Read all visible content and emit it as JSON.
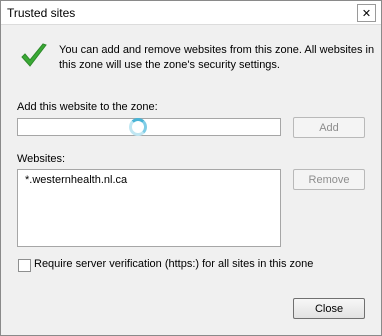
{
  "dialog": {
    "title": "Trusted sites",
    "close_glyph": "✕",
    "info_text": "You can add and remove websites from this zone. All websites in this zone will use the zone's security settings."
  },
  "add_section": {
    "label": "Add this website to the zone:",
    "input_value": "",
    "add_button": "Add"
  },
  "websites_section": {
    "label": "Websites:",
    "items": [
      "*.westernhealth.nl.ca"
    ],
    "remove_button": "Remove"
  },
  "options": {
    "require_https_label": "Require server verification (https:) for all sites in this zone",
    "require_https_checked": false
  },
  "footer": {
    "close_button": "Close"
  },
  "colors": {
    "check_green": "#3aa935",
    "spinner_blue": "#49b4d6"
  }
}
